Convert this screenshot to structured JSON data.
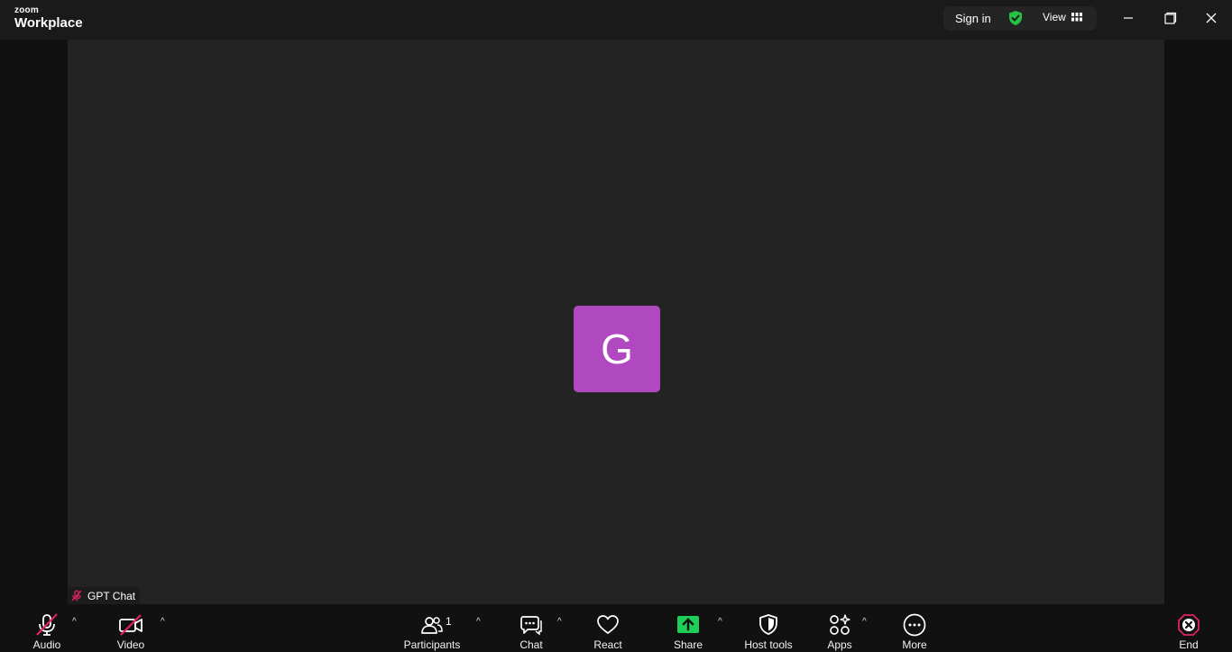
{
  "app": {
    "logo_top": "zoom",
    "logo_bottom": "Workplace"
  },
  "topbar": {
    "sign_in": "Sign in",
    "view": "View",
    "shield_color": "#25c141",
    "window_controls": [
      "minimize-icon",
      "restore-icon",
      "close-icon"
    ]
  },
  "meeting": {
    "avatar_initial": "G",
    "avatar_color": "#b048c0",
    "participant_name": "GPT Chat"
  },
  "toolbar": {
    "audio": "Audio",
    "video": "Video",
    "participants": "Participants",
    "participant_count": "1",
    "chat": "Chat",
    "react": "React",
    "share": "Share",
    "share_color": "#1dce57",
    "host_tools": "Host tools",
    "apps": "Apps",
    "more": "More",
    "end": "End",
    "end_color": "#e0245e"
  }
}
